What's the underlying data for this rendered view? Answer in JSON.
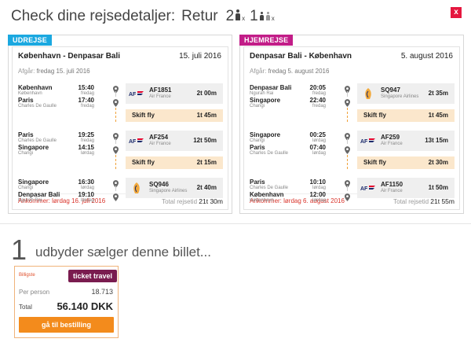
{
  "header": {
    "title": "Check dine rejsedetaljer:",
    "trip_type": "Retur",
    "adults": "2",
    "adults_suffix": "x",
    "children": "1",
    "children_suffix": "x"
  },
  "close_label": "x",
  "outbound": {
    "tag": "UDREJSE",
    "route": "København - Denpasar Bali",
    "date": "15. juli 2016",
    "afgar_label": "Afgår:",
    "afgar_value": "fredag 15. juli 2016",
    "segments": [
      {
        "from": "København",
        "from_sub": "København",
        "dep_time": "15:40",
        "dep_day": "fredag",
        "to": "Paris",
        "to_sub": "Charles De Gaulle",
        "arr_time": "17:40",
        "arr_day": "fredag",
        "flight": "AF1851",
        "airline": "Air France",
        "airline_logo": "air-france",
        "duration": "2t 00m"
      },
      {
        "from": "Paris",
        "from_sub": "Charles De Gaulle",
        "dep_time": "19:25",
        "dep_day": "fredag",
        "to": "Singapore",
        "to_sub": "Changi",
        "arr_time": "14:15",
        "arr_day": "lørdag",
        "flight": "AF254",
        "airline": "Air France",
        "airline_logo": "air-france",
        "duration": "12t 50m"
      },
      {
        "from": "Singapore",
        "from_sub": "Changi",
        "dep_time": "16:30",
        "dep_day": "lørdag",
        "to": "Denpasar Bali",
        "to_sub": "Ngurah Rai",
        "arr_time": "19:10",
        "arr_day": "lørdag",
        "flight": "SQ946",
        "airline": "Singapore Airlines",
        "airline_logo": "singapore-airlines",
        "duration": "2t 40m"
      }
    ],
    "changes": [
      {
        "label": "Skift fly",
        "duration": "1t 45m"
      },
      {
        "label": "Skift fly",
        "duration": "2t 15m"
      }
    ],
    "arrival": "Ankommer: lørdag 16. juli 2016",
    "total_label": "Total rejsetid",
    "total_value": "21t 30m"
  },
  "return": {
    "tag": "HJEMREJSE",
    "route": "Denpasar Bali - København",
    "date": "5. august 2016",
    "afgar_label": "Afgår:",
    "afgar_value": "fredag 5. august 2016",
    "segments": [
      {
        "from": "Denpasar Bali",
        "from_sub": "Ngurah Rai",
        "dep_time": "20:05",
        "dep_day": "fredag",
        "to": "Singapore",
        "to_sub": "Changi",
        "arr_time": "22:40",
        "arr_day": "fredag",
        "flight": "SQ947",
        "airline": "Singapore Airlines",
        "airline_logo": "singapore-airlines",
        "duration": "2t 35m"
      },
      {
        "from": "Singapore",
        "from_sub": "Changi",
        "dep_time": "00:25",
        "dep_day": "lørdag",
        "to": "Paris",
        "to_sub": "Charles De Gaulle",
        "arr_time": "07:40",
        "arr_day": "lørdag",
        "flight": "AF259",
        "airline": "Air France",
        "airline_logo": "air-france",
        "duration": "13t 15m"
      },
      {
        "from": "Paris",
        "from_sub": "Charles De Gaulle",
        "dep_time": "10:10",
        "dep_day": "lørdag",
        "to": "København",
        "to_sub": "København",
        "arr_time": "12:00",
        "arr_day": "lørdag",
        "flight": "AF1150",
        "airline": "Air France",
        "airline_logo": "air-france",
        "duration": "1t 50m"
      }
    ],
    "changes": [
      {
        "label": "Skift fly",
        "duration": "1t 45m"
      },
      {
        "label": "Skift fly",
        "duration": "2t 30m"
      }
    ],
    "arrival": "Ankommer: lørdag 6. august 2016",
    "total_label": "Total rejsetid",
    "total_value": "21t 55m"
  },
  "providers": {
    "count": "1",
    "text": "udbyder sælger denne billet..."
  },
  "offer": {
    "badge": "Billigste",
    "brand": "ticket travel",
    "per_person_label": "Per person",
    "per_person_value": "18.713",
    "total_label": "Total",
    "total_value": "56.140 DKK",
    "button": "gå til bestilling"
  },
  "colors": {
    "outbound_tag": "#1ba8e0",
    "return_tag": "#c21d88",
    "accent": "#f38b1c",
    "close": "#e5173f",
    "arrival": "#d9342b"
  }
}
